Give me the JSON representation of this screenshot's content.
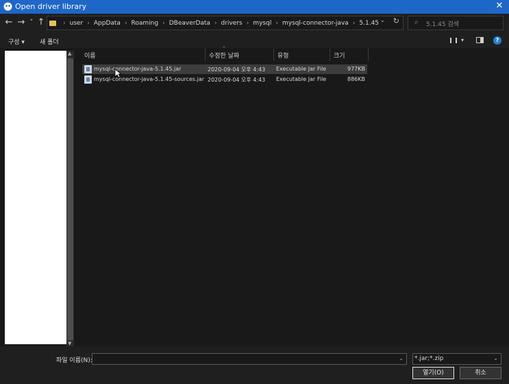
{
  "window": {
    "title": "Open driver library",
    "close_glyph": "✕"
  },
  "nav": {
    "back_glyph": "←",
    "forward_glyph": "→",
    "recent_glyph": "˅",
    "up_glyph": "↑",
    "breadcrumb": [
      "user",
      "AppData",
      "Roaming",
      "DBeaverData",
      "drivers",
      "mysql",
      "mysql-connector-java",
      "5.1.45"
    ],
    "separator": "›",
    "refresh_glyph": "↻",
    "dropdown_glyph": "⌄",
    "search_placeholder": "5.1.45 검색",
    "search_glyph": "⌕"
  },
  "toolbar": {
    "organize_label": "구성 ▾",
    "new_folder_label": "새 폴더",
    "view_dd_glyph": "▾",
    "help_glyph": "?"
  },
  "columns": {
    "name": "이름",
    "date": "수정한 날짜",
    "type": "유형",
    "size": "크기"
  },
  "files": [
    {
      "name": "mysql-connector-java-5.1.45.jar",
      "date": "2020-09-04 오후 4:43",
      "type": "Executable Jar File",
      "size": "977KB",
      "selected": true
    },
    {
      "name": "mysql-connector-java-5.1.45-sources.jar",
      "date": "2020-09-04 오후 4:43",
      "type": "Executable Jar File",
      "size": "886KB",
      "selected": false
    }
  ],
  "footer": {
    "filename_label": "파일 이름(N):",
    "filename_value": "",
    "filter_value": "*.jar;*.zip",
    "open_label": "열기(O)",
    "cancel_label": "취소"
  },
  "colors": {
    "titlebar": "#1e66c8",
    "background": "#191919",
    "selected_row": "#3d3d3d",
    "accent_help": "#2a7fd4"
  },
  "icons": [
    "dbeaver-app-icon",
    "close-icon",
    "back-arrow-icon",
    "forward-arrow-icon",
    "up-arrow-icon",
    "folder-icon",
    "refresh-icon",
    "search-icon",
    "view-options-icon",
    "preview-pane-icon",
    "help-icon",
    "jar-file-icon"
  ]
}
